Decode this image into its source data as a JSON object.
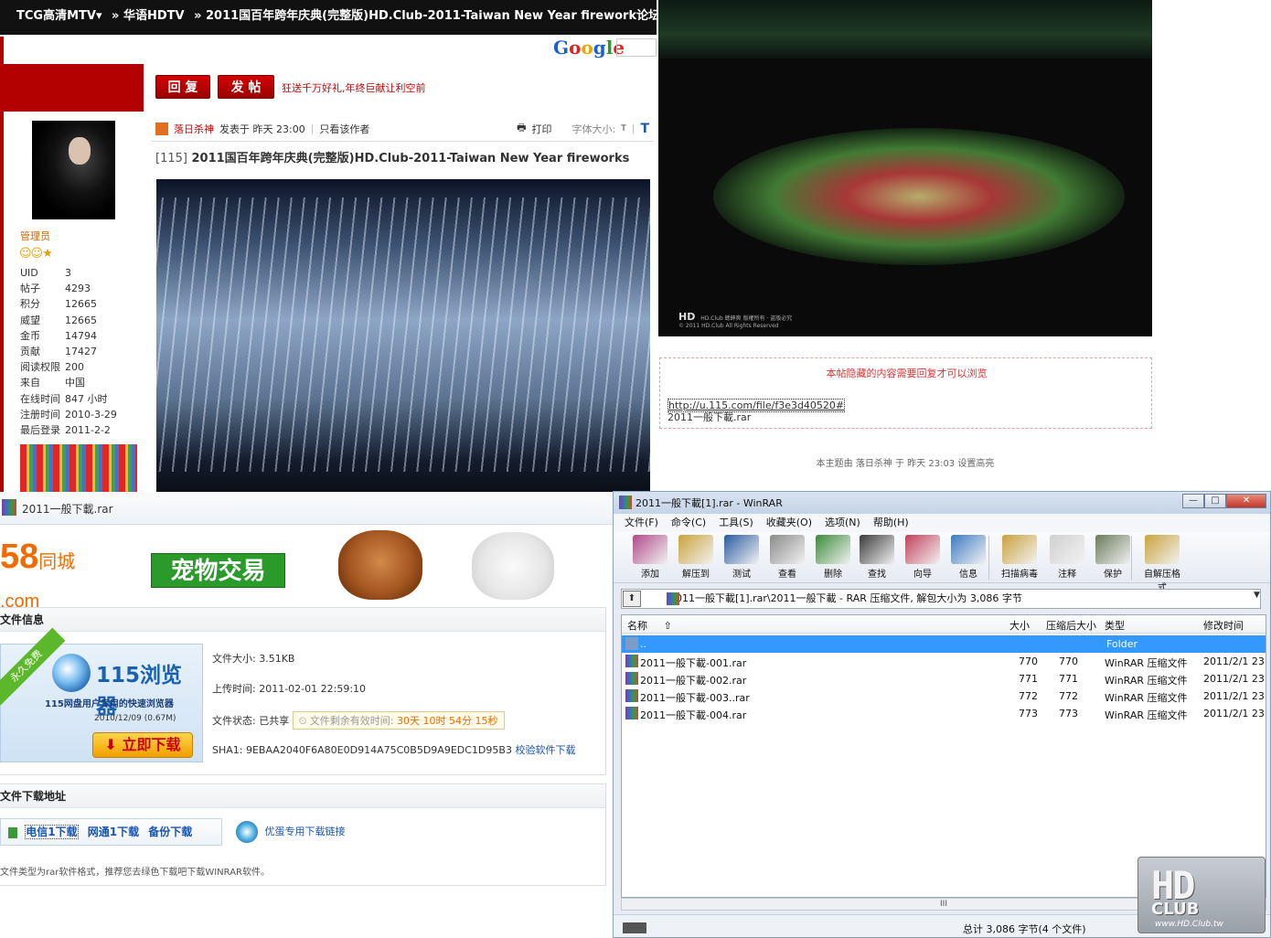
{
  "forum": {
    "breadcrumb": [
      "TCG高清MTV▾",
      "» 华语HDTV",
      "» 2011国百年跨年庆典(完整版)HD.Club-2011-Taiwan New Year firework论坛"
    ],
    "search_engine": "Google",
    "reply_label": "回 复",
    "post_label": "发 帖",
    "promo_text": "狂送千万好礼,年终巨献让利空前",
    "user": {
      "role": "管理员",
      "stats": [
        {
          "k": "UID",
          "v": "3"
        },
        {
          "k": "帖子",
          "v": "4293"
        },
        {
          "k": "积分",
          "v": "12665"
        },
        {
          "k": "威望",
          "v": "12665"
        },
        {
          "k": "金币",
          "v": "14794"
        },
        {
          "k": "贡献",
          "v": "17427"
        },
        {
          "k": "阅读权限",
          "v": "200"
        },
        {
          "k": "来自",
          "v": "中国"
        },
        {
          "k": "在线时间",
          "v": "847 小时"
        },
        {
          "k": "注册时间",
          "v": "2010-3-29"
        },
        {
          "k": "最后登录",
          "v": "2011-2-2"
        }
      ]
    },
    "post": {
      "author": "落日杀神",
      "posted": "发表于 昨天 23:00",
      "only_author": "只看该作者",
      "print": "打印",
      "font_size": "字体大小:",
      "font_t_small": "T",
      "font_t_big": "T",
      "tag": "[115]",
      "title": "2011国百年跨年庆典(完整版)HD.Club-2011-Taiwan New Year fireworks"
    }
  },
  "fireworks": {
    "watermark_brand": "HD",
    "watermark_line1": "HD.Club 蟋蟀爽 版權所有 · 盗版必究",
    "watermark_line2": "© 2011 HD.Club All Rights Reserved"
  },
  "hidden_box": {
    "notice": "本帖隐藏的内容需要回复才可以浏览",
    "link": "http://u.115.com/file/f3e3d40520#",
    "filename": "2011一般下載.rar"
  },
  "highlight_note": "本主题由 落日杀神 于 昨天 23:03 设置高亮",
  "download_page": {
    "tab_title": "2011一般下載.rar",
    "ad_logo": "58",
    "ad_logo_sub": "同城",
    "ad_logo_com": ".com",
    "ad_category": "宠物交易",
    "file_info_title": "文件信息",
    "promo": {
      "ribbon": "永久免费",
      "name": "115浏览器",
      "subtitle": "115网盘用户专用的快速浏览器",
      "version": "2010/12/09 (0.67M)",
      "button": "立即下载"
    },
    "size_label": "文件大小:",
    "size": "3.51KB",
    "upload_label": "上传时间:",
    "upload": "2011-02-01 22:59:10",
    "status_label": "文件状态:",
    "status": "已共享",
    "remaining_label": "文件剩余有效时间:",
    "remaining": "30天 10时 54分 15秒",
    "sha_label": "SHA1:",
    "sha": "9EBAA2040F6A80E0D914A75C0B5D9A9EDC1D95B3",
    "sha_link": "校验软件下载",
    "addr_title": "文件下载地址",
    "links": [
      "电信1下载",
      "网通1下载",
      "备份下载"
    ],
    "youdan": "优蛋专用下载链接",
    "note": "文件类型为rar软件格式，推荐您去绿色下载吧下载WINRAR软件。"
  },
  "winrar": {
    "title": "2011一般下載[1].rar - WinRAR",
    "window_buttons": [
      "—",
      "□",
      "✕"
    ],
    "menu": [
      "文件(F)",
      "命令(C)",
      "工具(S)",
      "收藏夹(O)",
      "选项(N)",
      "帮助(H)"
    ],
    "tools": [
      "添加",
      "解压到",
      "测试",
      "查看",
      "删除",
      "查找",
      "向导",
      "信息",
      "扫描病毒",
      "注释",
      "保护",
      "自解压格式"
    ],
    "path": "2011一般下載[1].rar\\2011一般下載 - RAR 压缩文件, 解包大小为 3,086 字节",
    "columns": [
      "名称",
      "大小",
      "压缩后大小",
      "类型",
      "修改时间"
    ],
    "rows": [
      {
        "name": "..",
        "size": "",
        "packed": "",
        "type": "Folder",
        "date": ""
      },
      {
        "name": "2011一般下載-001.rar",
        "size": "770",
        "packed": "770",
        "type": "WinRAR 压缩文件",
        "date": "2011/2/1 23"
      },
      {
        "name": "2011一般下載-002.rar",
        "size": "771",
        "packed": "771",
        "type": "WinRAR 压缩文件",
        "date": "2011/2/1 23"
      },
      {
        "name": "2011一般下載-003..rar",
        "size": "772",
        "packed": "772",
        "type": "WinRAR 压缩文件",
        "date": "2011/2/1 23"
      },
      {
        "name": "2011一般下載-004.rar",
        "size": "773",
        "packed": "773",
        "type": "WinRAR 压缩文件",
        "date": "2011/2/1 23"
      }
    ],
    "scroll_grip": "III",
    "status": "总计 3,086 字节(4 个文件)"
  },
  "hdclub": {
    "big": "HD",
    "club": "CLUB",
    "url": "www.HD.Club.tw"
  }
}
